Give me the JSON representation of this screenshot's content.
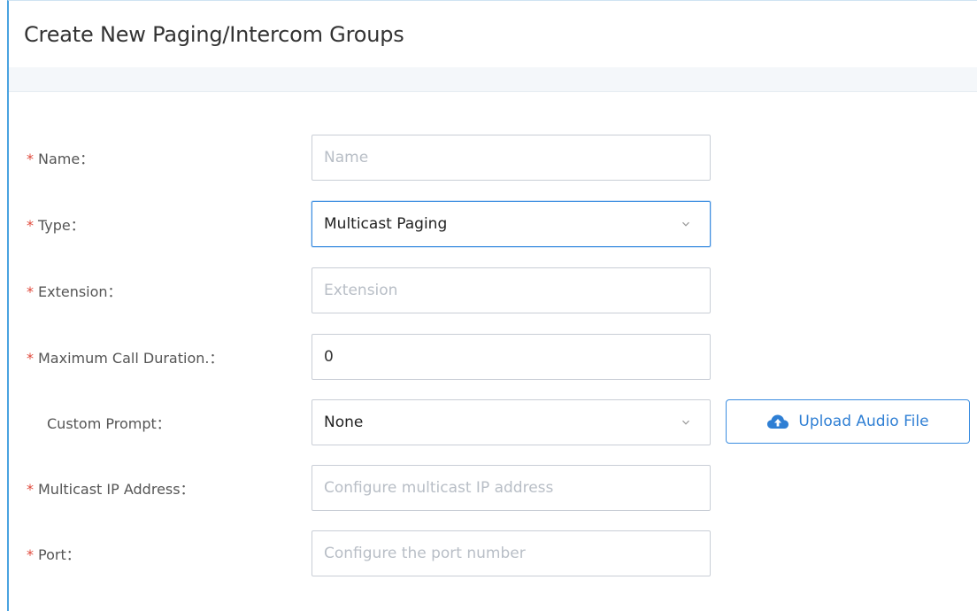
{
  "header": {
    "title": "Create New Paging/Intercom Groups"
  },
  "form": {
    "name": {
      "label": "Name",
      "placeholder": "Name",
      "value": ""
    },
    "type": {
      "label": "Type",
      "value": "Multicast Paging"
    },
    "extension": {
      "label": "Extension",
      "placeholder": "Extension",
      "value": ""
    },
    "max_call_duration": {
      "label": "Maximum Call Duration.",
      "value": "0"
    },
    "custom_prompt": {
      "label": "Custom Prompt",
      "value": "None"
    },
    "upload_audio": {
      "label": "Upload Audio File"
    },
    "multicast_ip": {
      "label": "Multicast IP Address",
      "placeholder": "Configure multicast IP address",
      "value": ""
    },
    "port": {
      "label": "Port",
      "placeholder": "Configure the port number",
      "value": ""
    },
    "required_mark": "*",
    "colon": "："
  },
  "colors": {
    "accent": "#3b8de0",
    "required": "#e04a3c",
    "border": "#c9ced6"
  }
}
